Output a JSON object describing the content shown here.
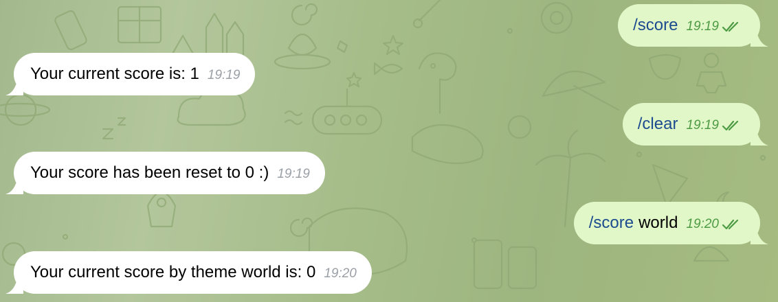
{
  "theme": {
    "incoming_bg": "#ffffff",
    "outgoing_bg": "#e1f7c8",
    "command_color": "#1c4b8f",
    "outgoing_time_color": "#4d9a44",
    "incoming_time_color": "#9aa0a6",
    "wallpaper": "#a8bd8c"
  },
  "messages": [
    {
      "direction": "outgoing",
      "command": "/score",
      "text": "",
      "time": "19:19",
      "status": "read-double-check-icon"
    },
    {
      "direction": "incoming",
      "text": "Your current score is: 1",
      "time": "19:19"
    },
    {
      "direction": "outgoing",
      "command": "/clear",
      "text": "",
      "time": "19:19",
      "status": "read-double-check-icon"
    },
    {
      "direction": "incoming",
      "text": "Your score has been reset to 0 :)",
      "time": "19:19"
    },
    {
      "direction": "outgoing",
      "command": "/score",
      "text": "world",
      "time": "19:20",
      "status": "read-double-check-icon"
    },
    {
      "direction": "incoming",
      "text": "Your current score by theme world is: 0",
      "time": "19:20"
    }
  ]
}
